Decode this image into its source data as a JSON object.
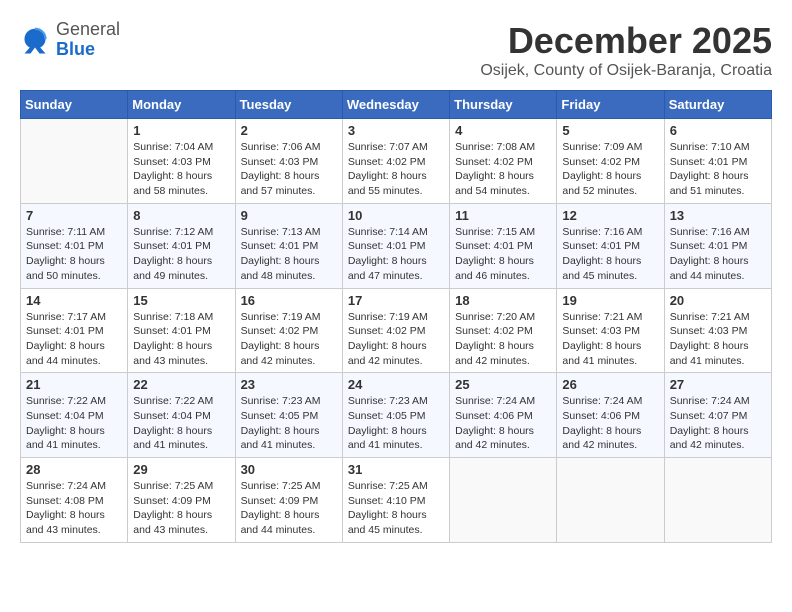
{
  "logo": {
    "general": "General",
    "blue": "Blue"
  },
  "title": {
    "month": "December 2025",
    "location": "Osijek, County of Osijek-Baranja, Croatia"
  },
  "weekdays": [
    "Sunday",
    "Monday",
    "Tuesday",
    "Wednesday",
    "Thursday",
    "Friday",
    "Saturday"
  ],
  "weeks": [
    [
      {
        "day": "",
        "sunrise": "",
        "sunset": "",
        "daylight": ""
      },
      {
        "day": "1",
        "sunrise": "Sunrise: 7:04 AM",
        "sunset": "Sunset: 4:03 PM",
        "daylight": "Daylight: 8 hours and 58 minutes."
      },
      {
        "day": "2",
        "sunrise": "Sunrise: 7:06 AM",
        "sunset": "Sunset: 4:03 PM",
        "daylight": "Daylight: 8 hours and 57 minutes."
      },
      {
        "day": "3",
        "sunrise": "Sunrise: 7:07 AM",
        "sunset": "Sunset: 4:02 PM",
        "daylight": "Daylight: 8 hours and 55 minutes."
      },
      {
        "day": "4",
        "sunrise": "Sunrise: 7:08 AM",
        "sunset": "Sunset: 4:02 PM",
        "daylight": "Daylight: 8 hours and 54 minutes."
      },
      {
        "day": "5",
        "sunrise": "Sunrise: 7:09 AM",
        "sunset": "Sunset: 4:02 PM",
        "daylight": "Daylight: 8 hours and 52 minutes."
      },
      {
        "day": "6",
        "sunrise": "Sunrise: 7:10 AM",
        "sunset": "Sunset: 4:01 PM",
        "daylight": "Daylight: 8 hours and 51 minutes."
      }
    ],
    [
      {
        "day": "7",
        "sunrise": "Sunrise: 7:11 AM",
        "sunset": "Sunset: 4:01 PM",
        "daylight": "Daylight: 8 hours and 50 minutes."
      },
      {
        "day": "8",
        "sunrise": "Sunrise: 7:12 AM",
        "sunset": "Sunset: 4:01 PM",
        "daylight": "Daylight: 8 hours and 49 minutes."
      },
      {
        "day": "9",
        "sunrise": "Sunrise: 7:13 AM",
        "sunset": "Sunset: 4:01 PM",
        "daylight": "Daylight: 8 hours and 48 minutes."
      },
      {
        "day": "10",
        "sunrise": "Sunrise: 7:14 AM",
        "sunset": "Sunset: 4:01 PM",
        "daylight": "Daylight: 8 hours and 47 minutes."
      },
      {
        "day": "11",
        "sunrise": "Sunrise: 7:15 AM",
        "sunset": "Sunset: 4:01 PM",
        "daylight": "Daylight: 8 hours and 46 minutes."
      },
      {
        "day": "12",
        "sunrise": "Sunrise: 7:16 AM",
        "sunset": "Sunset: 4:01 PM",
        "daylight": "Daylight: 8 hours and 45 minutes."
      },
      {
        "day": "13",
        "sunrise": "Sunrise: 7:16 AM",
        "sunset": "Sunset: 4:01 PM",
        "daylight": "Daylight: 8 hours and 44 minutes."
      }
    ],
    [
      {
        "day": "14",
        "sunrise": "Sunrise: 7:17 AM",
        "sunset": "Sunset: 4:01 PM",
        "daylight": "Daylight: 8 hours and 44 minutes."
      },
      {
        "day": "15",
        "sunrise": "Sunrise: 7:18 AM",
        "sunset": "Sunset: 4:01 PM",
        "daylight": "Daylight: 8 hours and 43 minutes."
      },
      {
        "day": "16",
        "sunrise": "Sunrise: 7:19 AM",
        "sunset": "Sunset: 4:02 PM",
        "daylight": "Daylight: 8 hours and 42 minutes."
      },
      {
        "day": "17",
        "sunrise": "Sunrise: 7:19 AM",
        "sunset": "Sunset: 4:02 PM",
        "daylight": "Daylight: 8 hours and 42 minutes."
      },
      {
        "day": "18",
        "sunrise": "Sunrise: 7:20 AM",
        "sunset": "Sunset: 4:02 PM",
        "daylight": "Daylight: 8 hours and 42 minutes."
      },
      {
        "day": "19",
        "sunrise": "Sunrise: 7:21 AM",
        "sunset": "Sunset: 4:03 PM",
        "daylight": "Daylight: 8 hours and 41 minutes."
      },
      {
        "day": "20",
        "sunrise": "Sunrise: 7:21 AM",
        "sunset": "Sunset: 4:03 PM",
        "daylight": "Daylight: 8 hours and 41 minutes."
      }
    ],
    [
      {
        "day": "21",
        "sunrise": "Sunrise: 7:22 AM",
        "sunset": "Sunset: 4:04 PM",
        "daylight": "Daylight: 8 hours and 41 minutes."
      },
      {
        "day": "22",
        "sunrise": "Sunrise: 7:22 AM",
        "sunset": "Sunset: 4:04 PM",
        "daylight": "Daylight: 8 hours and 41 minutes."
      },
      {
        "day": "23",
        "sunrise": "Sunrise: 7:23 AM",
        "sunset": "Sunset: 4:05 PM",
        "daylight": "Daylight: 8 hours and 41 minutes."
      },
      {
        "day": "24",
        "sunrise": "Sunrise: 7:23 AM",
        "sunset": "Sunset: 4:05 PM",
        "daylight": "Daylight: 8 hours and 41 minutes."
      },
      {
        "day": "25",
        "sunrise": "Sunrise: 7:24 AM",
        "sunset": "Sunset: 4:06 PM",
        "daylight": "Daylight: 8 hours and 42 minutes."
      },
      {
        "day": "26",
        "sunrise": "Sunrise: 7:24 AM",
        "sunset": "Sunset: 4:06 PM",
        "daylight": "Daylight: 8 hours and 42 minutes."
      },
      {
        "day": "27",
        "sunrise": "Sunrise: 7:24 AM",
        "sunset": "Sunset: 4:07 PM",
        "daylight": "Daylight: 8 hours and 42 minutes."
      }
    ],
    [
      {
        "day": "28",
        "sunrise": "Sunrise: 7:24 AM",
        "sunset": "Sunset: 4:08 PM",
        "daylight": "Daylight: 8 hours and 43 minutes."
      },
      {
        "day": "29",
        "sunrise": "Sunrise: 7:25 AM",
        "sunset": "Sunset: 4:09 PM",
        "daylight": "Daylight: 8 hours and 43 minutes."
      },
      {
        "day": "30",
        "sunrise": "Sunrise: 7:25 AM",
        "sunset": "Sunset: 4:09 PM",
        "daylight": "Daylight: 8 hours and 44 minutes."
      },
      {
        "day": "31",
        "sunrise": "Sunrise: 7:25 AM",
        "sunset": "Sunset: 4:10 PM",
        "daylight": "Daylight: 8 hours and 45 minutes."
      },
      {
        "day": "",
        "sunrise": "",
        "sunset": "",
        "daylight": ""
      },
      {
        "day": "",
        "sunrise": "",
        "sunset": "",
        "daylight": ""
      },
      {
        "day": "",
        "sunrise": "",
        "sunset": "",
        "daylight": ""
      }
    ]
  ]
}
